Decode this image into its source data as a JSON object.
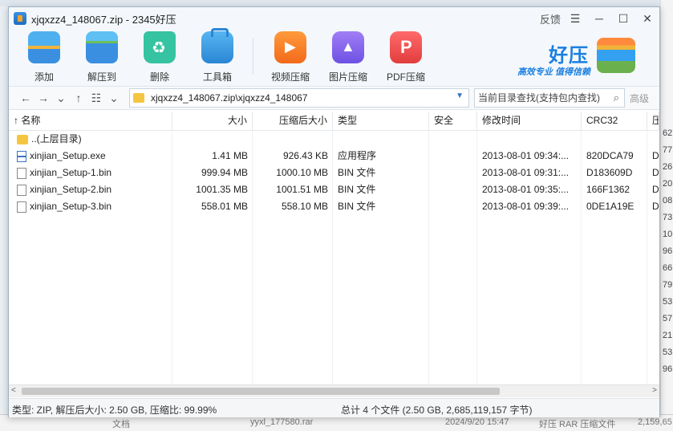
{
  "window": {
    "title": "xjqxzz4_148067.zip - 2345好压",
    "feedback": "反馈"
  },
  "toolbar": {
    "buttons": [
      {
        "label": "添加",
        "icon": "add-icon"
      },
      {
        "label": "解压到",
        "icon": "extract-icon"
      },
      {
        "label": "删除",
        "icon": "recycle-icon"
      },
      {
        "label": "工具箱",
        "icon": "toolbox-icon"
      },
      {
        "label": "视频压缩",
        "icon": "video-icon"
      },
      {
        "label": "图片压缩",
        "icon": "image-icon"
      },
      {
        "label": "PDF压缩",
        "icon": "pdf-icon"
      }
    ],
    "brand_name": "好压",
    "brand_slogan": "高效专业  值得信赖"
  },
  "address": {
    "path": "xjqxzz4_148067.zip\\xjqxzz4_148067",
    "search_placeholder": "当前目录查找(支持包内查找)",
    "advanced": "高级"
  },
  "table": {
    "headers": [
      "名称",
      "大小",
      "压缩后大小",
      "类型",
      "安全",
      "修改时间",
      "CRC32",
      "压"
    ],
    "rows": [
      {
        "name": "..(上层目录)",
        "size": "",
        "packed": "",
        "type": "",
        "safe": "",
        "mtime": "",
        "crc": "",
        "more": "",
        "icon": "folder"
      },
      {
        "name": "xinjian_Setup.exe",
        "size": "1.41 MB",
        "packed": "926.43 KB",
        "type": "应用程序",
        "safe": "",
        "mtime": "2013-08-01 09:34:...",
        "crc": "820DCA79",
        "more": "De",
        "icon": "exe"
      },
      {
        "name": "xinjian_Setup-1.bin",
        "size": "999.94 MB",
        "packed": "1000.10 MB",
        "type": "BIN 文件",
        "safe": "",
        "mtime": "2013-08-01 09:31:...",
        "crc": "D183609D",
        "more": "De",
        "icon": "file"
      },
      {
        "name": "xinjian_Setup-2.bin",
        "size": "1001.35 MB",
        "packed": "1001.51 MB",
        "type": "BIN 文件",
        "safe": "",
        "mtime": "2013-08-01 09:35:...",
        "crc": "166F1362",
        "more": "De",
        "icon": "file"
      },
      {
        "name": "xinjian_Setup-3.bin",
        "size": "558.01 MB",
        "packed": "558.10 MB",
        "type": "BIN 文件",
        "safe": "",
        "mtime": "2013-08-01 09:39:...",
        "crc": "0DE1A19E",
        "more": "De",
        "icon": "file"
      }
    ]
  },
  "status": {
    "left": "类型: ZIP, 解压后大小: 2.50 GB, 压缩比: 99.99%",
    "right": "总计 4 个文件 (2.50 GB, 2,685,119,157 字节)"
  },
  "background": {
    "right_numbers": [
      "62",
      "77",
      "26",
      "20",
      "08",
      "73",
      "10",
      "96",
      "66",
      "79",
      "53",
      "57",
      "21",
      "53",
      "96"
    ],
    "bottom_items": [
      "文档",
      "yyxl_177580.rar",
      "2024/9/20 15:47",
      "好压 RAR 压缩文件",
      "2,159,65"
    ]
  }
}
